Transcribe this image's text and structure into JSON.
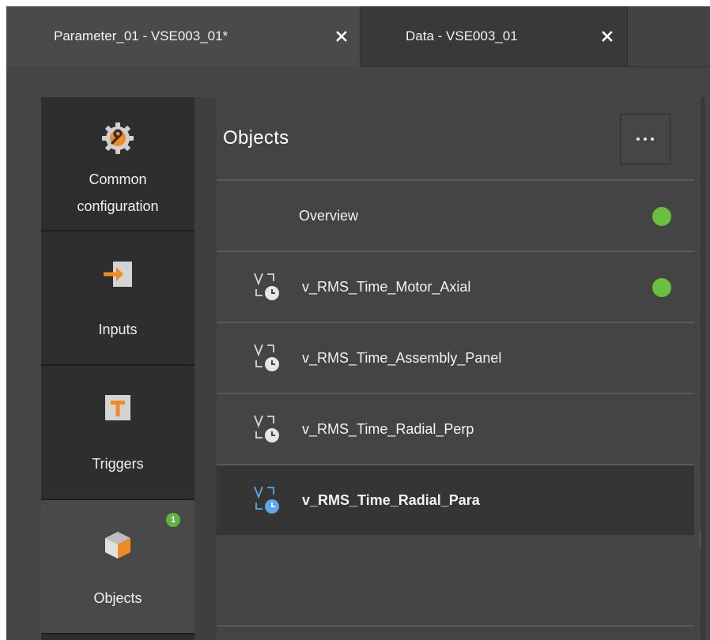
{
  "tabs": [
    {
      "label": "Parameter_01 - VSE003_01*",
      "active": true
    },
    {
      "label": "Data - VSE003_01",
      "active": false
    }
  ],
  "sidebar": {
    "items": [
      {
        "label_line1": "Common",
        "label_line2": "configuration",
        "icon": "gear-wrench-icon"
      },
      {
        "label": "Inputs",
        "icon": "input-arrow-icon"
      },
      {
        "label": "Triggers",
        "icon": "trigger-t-icon"
      },
      {
        "label": "Objects",
        "icon": "cube-icon",
        "badge": "1",
        "active": true
      }
    ]
  },
  "panel": {
    "title": "Objects",
    "more_icon": "ellipsis-icon",
    "rows": [
      {
        "label": "Overview",
        "status": "ok"
      },
      {
        "label": "v_RMS_Time_Motor_Axial",
        "status": "ok",
        "icon": "rms-time-icon"
      },
      {
        "label": "v_RMS_Time_Assembly_Panel",
        "icon": "rms-time-icon"
      },
      {
        "label": "v_RMS_Time_Radial_Perp",
        "icon": "rms-time-icon"
      },
      {
        "label": "v_RMS_Time_Radial_Para",
        "icon": "rms-time-icon",
        "selected": true
      }
    ]
  },
  "colors": {
    "status_ok": "#6bbf3f",
    "accent_orange": "#f08a24",
    "selected_icon_blue": "#5aa7ea"
  }
}
